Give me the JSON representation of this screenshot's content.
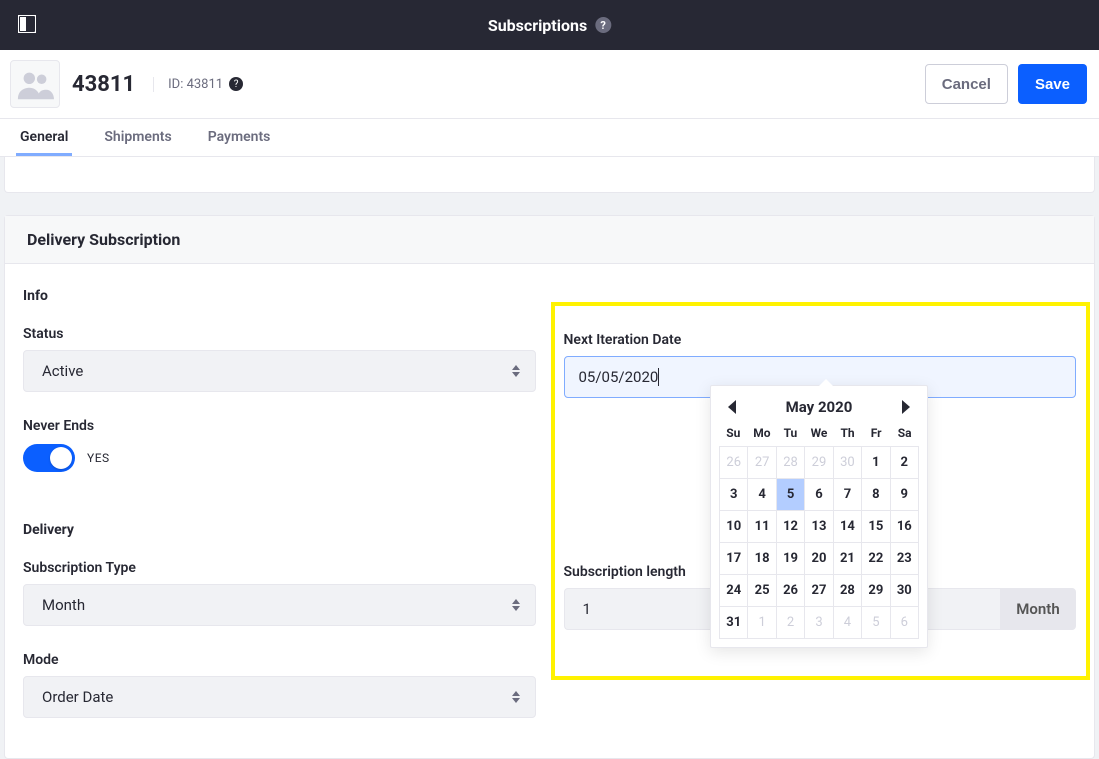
{
  "topbar": {
    "title": "Subscriptions"
  },
  "header": {
    "title": "43811",
    "id_label": "ID: 43811",
    "cancel": "Cancel",
    "save": "Save"
  },
  "tabs": [
    {
      "label": "General",
      "active": true
    },
    {
      "label": "Shipments",
      "active": false
    },
    {
      "label": "Payments",
      "active": false
    }
  ],
  "section": {
    "title": "Delivery Subscription"
  },
  "info": {
    "group": "Info",
    "status_label": "Status",
    "status_value": "Active",
    "never_ends_label": "Never Ends",
    "never_ends_value": "YES"
  },
  "delivery": {
    "group": "Delivery",
    "subscription_type_label": "Subscription Type",
    "subscription_type_value": "Month",
    "mode_label": "Mode",
    "mode_value": "Order Date"
  },
  "right": {
    "next_iteration_label": "Next Iteration Date",
    "next_iteration_value": "05/05/2020",
    "subscription_length_label": "Subscription length",
    "subscription_length_value": "1",
    "subscription_length_unit": "Month"
  },
  "datepicker": {
    "title": "May 2020",
    "dow": [
      "Su",
      "Mo",
      "Tu",
      "We",
      "Th",
      "Fr",
      "Sa"
    ],
    "leading": [
      26,
      27,
      28,
      29,
      30
    ],
    "days": [
      1,
      2,
      3,
      4,
      5,
      6,
      7,
      8,
      9,
      10,
      11,
      12,
      13,
      14,
      15,
      16,
      17,
      18,
      19,
      20,
      21,
      22,
      23,
      24,
      25,
      26,
      27,
      28,
      29,
      30,
      31
    ],
    "trailing": [
      1,
      2,
      3,
      4,
      5,
      6
    ],
    "selected": 5
  }
}
